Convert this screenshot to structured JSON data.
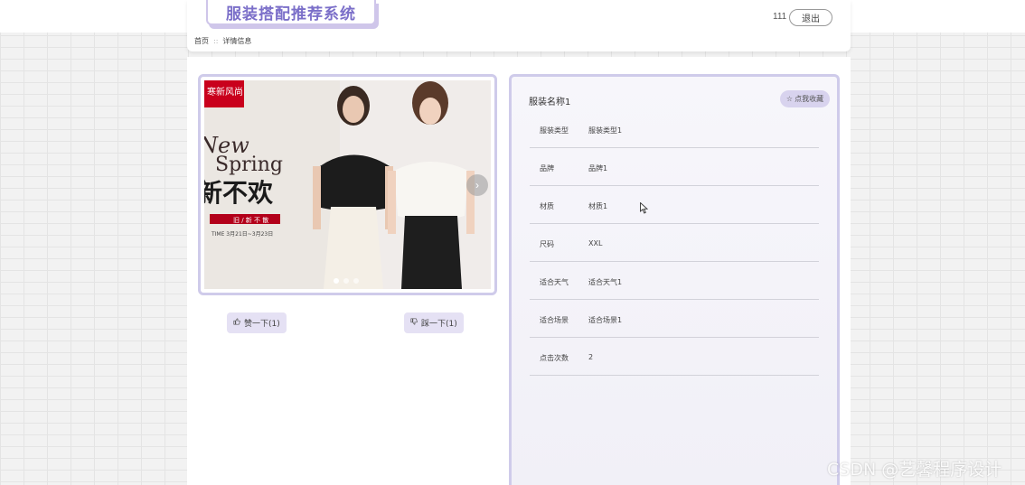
{
  "header": {
    "logo_text": "服装搭配推荐系统",
    "username": "111",
    "logout_label": "退出"
  },
  "breadcrumb": {
    "home": "首页",
    "separator": "::",
    "current": "详情信息"
  },
  "carousel": {
    "image_brand_tag": "寒新风尚",
    "image_headline_1": "New",
    "image_headline_2": "Spring",
    "image_slogan": "新不欢",
    "image_red_label": "旧 / 新 不 散",
    "image_time": "TIME 3月21日~3月23日",
    "slides": 3,
    "active_slide": 1,
    "next_icon": "chevron-right-icon"
  },
  "actions": {
    "like_label": "赞一下(1)",
    "dislike_label": "踩一下(1)"
  },
  "detail": {
    "title": "服装名称1",
    "favorite_label": "点我收藏",
    "rows": [
      {
        "label": "服装类型",
        "value": "服装类型1"
      },
      {
        "label": "品牌",
        "value": "品牌1"
      },
      {
        "label": "材质",
        "value": "材质1"
      },
      {
        "label": "尺码",
        "value": "XXL"
      },
      {
        "label": "适合天气",
        "value": "适合天气1"
      },
      {
        "label": "适合场景",
        "value": "适合场景1"
      },
      {
        "label": "点击次数",
        "value": "2"
      }
    ]
  },
  "watermark": "CSDN @艺馨程序设计",
  "colors": {
    "accent": "#7b6fc9",
    "panel_border": "#cfcbea",
    "button_bg": "#e5e1f4"
  }
}
